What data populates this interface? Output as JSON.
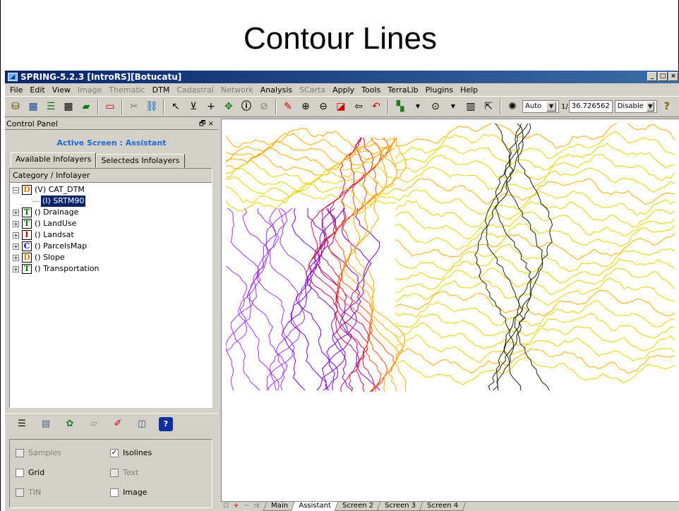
{
  "slide": {
    "title": "Contour Lines"
  },
  "window": {
    "title": "SPRING-5.2.3 [IntroRS][Botucatu]",
    "min": "_",
    "max": "□",
    "close": "×"
  },
  "menu": [
    {
      "label": "File",
      "enabled": true
    },
    {
      "label": "Edit",
      "enabled": true
    },
    {
      "label": "View",
      "enabled": true
    },
    {
      "label": "Image",
      "enabled": false
    },
    {
      "label": "Thematic",
      "enabled": false
    },
    {
      "label": "DTM",
      "enabled": true
    },
    {
      "label": "Cadastral",
      "enabled": false
    },
    {
      "label": "Network",
      "enabled": false
    },
    {
      "label": "Analysis",
      "enabled": true
    },
    {
      "label": "SCarta",
      "enabled": false
    },
    {
      "label": "Apply",
      "enabled": true
    },
    {
      "label": "Tools",
      "enabled": true
    },
    {
      "label": "TerraLib",
      "enabled": true
    },
    {
      "label": "Plugins",
      "enabled": true
    },
    {
      "label": "Help",
      "enabled": true
    }
  ],
  "toolbar": {
    "zoom_mode": "Auto",
    "scale_prefix": "1/",
    "scale_value": "36.726562",
    "mode": "Disable",
    "help": "?"
  },
  "control_panel": {
    "title": "Control Panel",
    "float_icon": "🗗 ×",
    "active_screen": "Active Screen : Assistant",
    "tabs": [
      "Available Infolayers",
      "Selecteds Infolayers"
    ],
    "tree_header": "Category / Infolayer",
    "tree": [
      {
        "letter": "D",
        "label": "(V) CAT_DTM",
        "color": "#d08000",
        "expanded": true,
        "children": [
          {
            "label": "(I) SRTM90",
            "selected": true
          }
        ]
      },
      {
        "letter": "T",
        "label": "() Drainage",
        "color": "#008000"
      },
      {
        "letter": "T",
        "label": "() LandUse",
        "color": "#008000"
      },
      {
        "letter": "I",
        "label": "() Landsat",
        "color": "#d00000"
      },
      {
        "letter": "C",
        "label": "() ParcelsMap",
        "color": "#0000d0"
      },
      {
        "letter": "D",
        "label": "() Slope",
        "color": "#d08000"
      },
      {
        "letter": "T",
        "label": "() Transportation",
        "color": "#008000"
      }
    ],
    "options": {
      "samples": {
        "label": "Samples",
        "checked": false,
        "enabled": false
      },
      "isolines": {
        "label": "Isolines",
        "checked": true,
        "enabled": true
      },
      "grid": {
        "label": "Grid",
        "checked": false,
        "enabled": true
      },
      "text": {
        "label": "Text",
        "checked": false,
        "enabled": false
      },
      "tin": {
        "label": "TIN",
        "checked": false,
        "enabled": false
      },
      "image": {
        "label": "Image",
        "checked": false,
        "enabled": true
      }
    }
  },
  "screen_tabs": {
    "nav": [
      "⊡",
      "+",
      "−",
      "⇉"
    ],
    "tabs": [
      "Main",
      "Assistant",
      "Screen 2",
      "Screen 3",
      "Screen 4"
    ],
    "active": "Assistant"
  },
  "map": {
    "palette": [
      "#7a00d6",
      "#a030ff",
      "#cc1040",
      "#ff5010",
      "#ffaa00",
      "#e6d000",
      "#202000"
    ]
  }
}
